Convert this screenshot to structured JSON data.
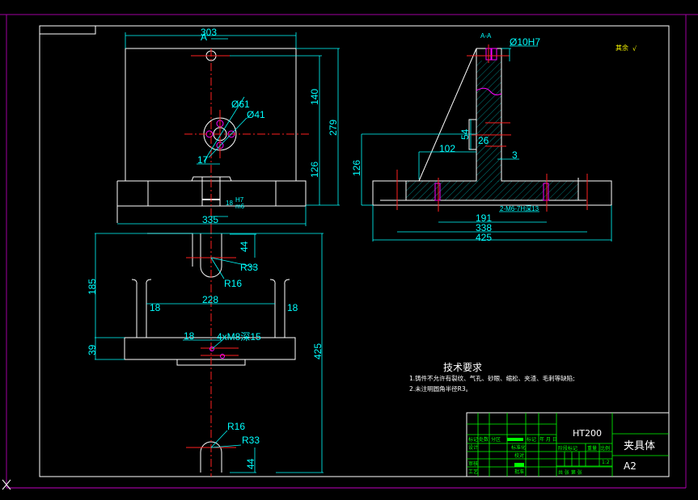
{
  "colors": {
    "background": "#000000",
    "outline": "#ffffff",
    "dimension": "#00ffff",
    "centerline": "#ff2020",
    "frame": "#c000c0",
    "title_block": "#00ff00"
  },
  "front_view": {
    "dims": {
      "width_top": "303",
      "width_base": "335",
      "h140": "140",
      "h279": "279",
      "h126": "126",
      "dia61": "Ø61",
      "dia41": "Ø41",
      "d17": "17",
      "d18": "18",
      "fit_upper": "H7",
      "fit_lower": "m6",
      "section_mark": "A"
    }
  },
  "section_view": {
    "title": "A-A",
    "dims": {
      "dia10": "Ø10H7",
      "d54": "54",
      "d26": "26",
      "d102": "102",
      "d3": "3",
      "h126": "126",
      "d191": "191",
      "d338": "338",
      "d425": "425",
      "thread": "2-M6-7H深13"
    }
  },
  "roughness": {
    "label": "其余",
    "symbol": "√"
  },
  "top_view": {
    "dims": {
      "d44_top": "44",
      "r33_top": "R33",
      "r16_top": "R16",
      "d185": "185",
      "d228": "228",
      "d18_left": "18",
      "d18_right": "18",
      "d18_mid": "18",
      "thread": "4xM8深15",
      "d39": "39",
      "d425": "425",
      "r16_bottom": "R16",
      "r33_bottom": "R33",
      "d44_bottom": "44"
    }
  },
  "technical_requirements": {
    "title": "技术要求",
    "items": [
      "1.铸件不允许有裂纹、气孔、砂眼、缩松、夹渣、毛刺等缺陷;",
      "2.未注明圆角半径R3。"
    ]
  },
  "title_block": {
    "material": "HT200",
    "part_name": "夹具体",
    "drawing_no": "A2",
    "scale": "1:2",
    "labels": {
      "mark": "标记",
      "count": "处数",
      "zone": "分区",
      "date": "年 月 日",
      "design": "设计",
      "standard": "标准化",
      "review": "审核",
      "process": "工艺",
      "approve": "批准",
      "proofread": "校对",
      "stage": "阶段标记",
      "weight": "重量",
      "ratio": "比例",
      "sheets": "共 张 第 张"
    }
  }
}
